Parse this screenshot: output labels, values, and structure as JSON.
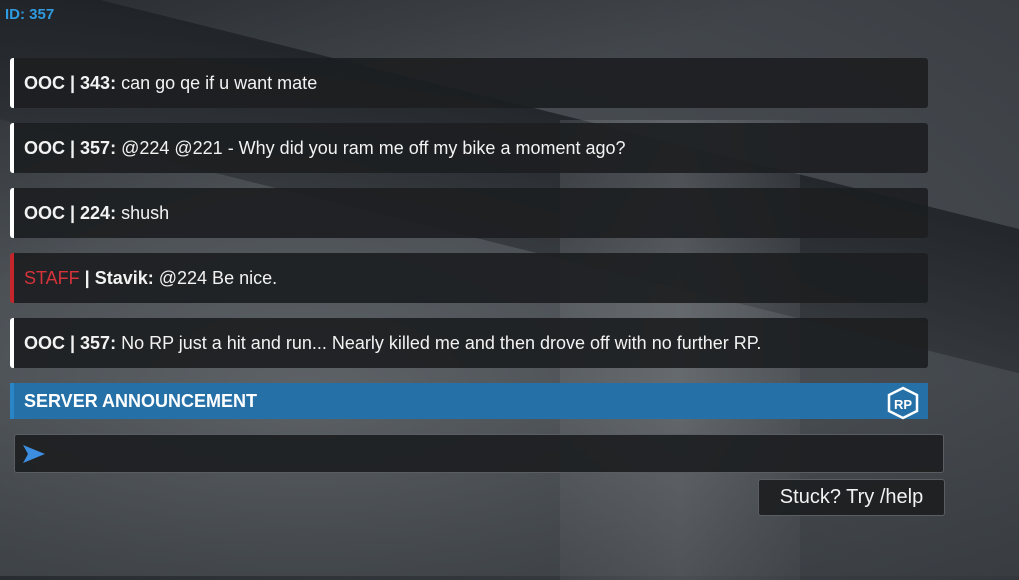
{
  "player_id_label": "ID: 357",
  "messages": [
    {
      "prefix": "OOC | 343:",
      "text": " can go qe if u want mate"
    },
    {
      "prefix": "OOC | 357:",
      "text": " @224 @221 - Why did you ram me off my bike a moment ago?"
    },
    {
      "prefix": "OOC | 224:",
      "text": " shush"
    },
    {
      "tag": "STAFF",
      "prefix": " | Stavik:",
      "text": " @224 Be nice."
    },
    {
      "prefix": "OOC | 357:",
      "text": " No RP just a hit and run... Nearly killed me and then drove off with no further RP."
    }
  ],
  "announcement": {
    "title": "SERVER ANNOUNCEMENT",
    "logo_icon": "rp-server-logo-icon",
    "color": "#2670a8"
  },
  "chat_input": {
    "value": "",
    "placeholder": "",
    "send_icon": "send-arrow-icon"
  },
  "help_button": {
    "label": "Stuck? Try /help"
  },
  "colors": {
    "id_label": "#2f9be0",
    "staff": "#d6333a",
    "staff_border": "#c4262c",
    "ooc_border": "#ffffff"
  }
}
